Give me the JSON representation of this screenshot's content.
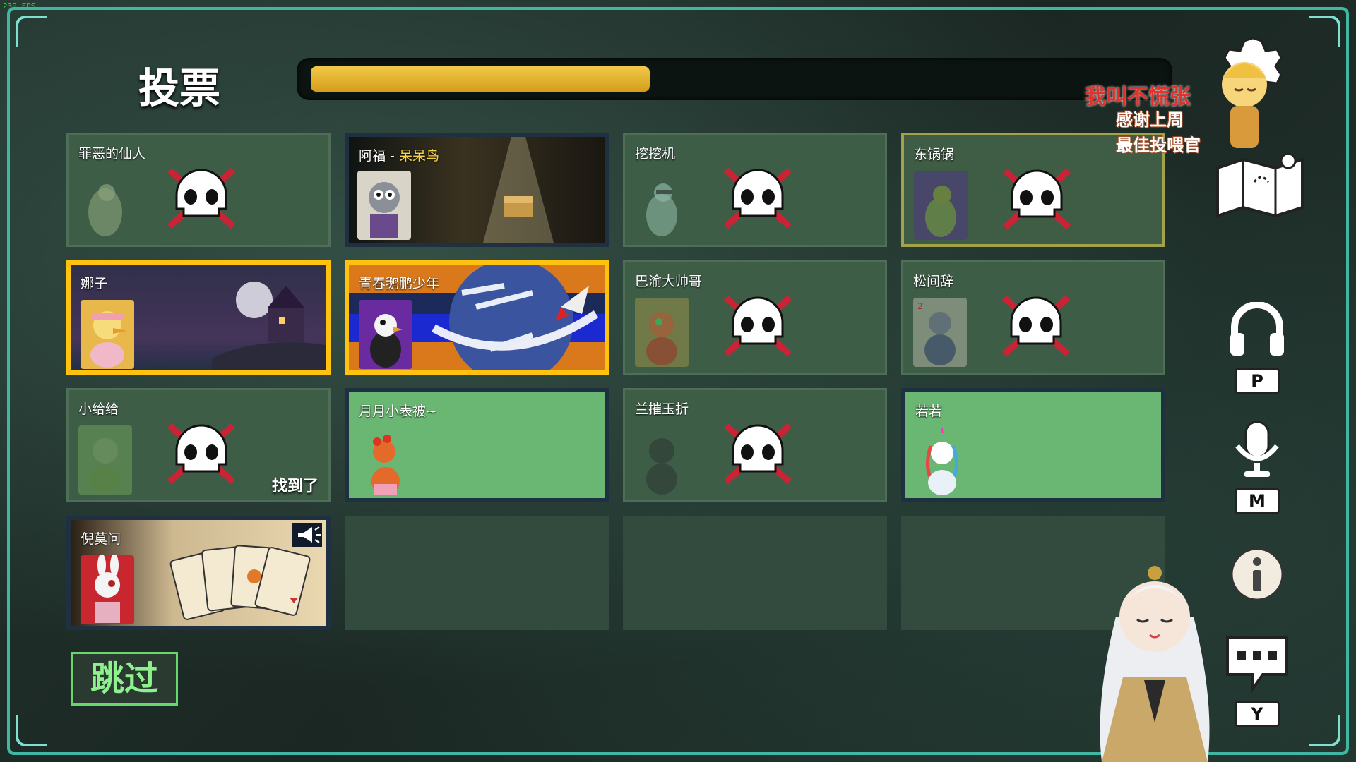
{
  "hud": {
    "fps": "239 FPS"
  },
  "vote": {
    "title": "投票",
    "timer_progress": 0.4,
    "skip_label": "跳过"
  },
  "players": [
    {
      "name": "罪恶的仙人",
      "state": "dead",
      "avatar_color": "#b2a86a"
    },
    {
      "name": "阿福 - ",
      "role": "呆呆鸟",
      "state": "dead-spotlight",
      "avatar_color": "#8a8f98"
    },
    {
      "name": "挖挖机",
      "state": "dead",
      "avatar_color": "#8cb5a2"
    },
    {
      "name": "东锅锅",
      "state": "dead-self",
      "avatar_color": "#7a8f3d"
    },
    {
      "name": "娜子",
      "state": "voted",
      "avatar_color": "#f0d060"
    },
    {
      "name": "青春鹅鹏少年",
      "state": "voted",
      "avatar_color": "#ffffff"
    },
    {
      "name": "巴渝大帅哥",
      "state": "dead",
      "avatar_color": "#c56a3a"
    },
    {
      "name": "松间辞",
      "state": "dead",
      "avatar_color": "#6e7a8a"
    },
    {
      "name": "小给给",
      "state": "dead",
      "avatar_color": "#7fa86a",
      "badge": "找到了"
    },
    {
      "name": "月月小表被~",
      "state": "alive",
      "avatar_color": "#e36a2b"
    },
    {
      "name": "兰摧玉折",
      "state": "dead",
      "avatar_color": "#3f4b45"
    },
    {
      "name": "若若",
      "state": "alive",
      "avatar_color": "#ffffff"
    },
    {
      "name": "倪莫问",
      "state": "alive-cards",
      "avatar_color": "#c9272f"
    }
  ],
  "sidebar": {
    "voice_key": "P",
    "mic_key": "M",
    "chat_key": "Y"
  },
  "overlay": {
    "streamer_line1": "我叫不慌张",
    "streamer_line2": "感谢上周",
    "streamer_line3": "最佳投喂官"
  },
  "colors": {
    "accent": "#3fb7a3",
    "voted_border": "#ffc20e",
    "timer": "#e9b52f",
    "dead_card": "#3e5d47",
    "alive_panel": "#6ab673"
  }
}
